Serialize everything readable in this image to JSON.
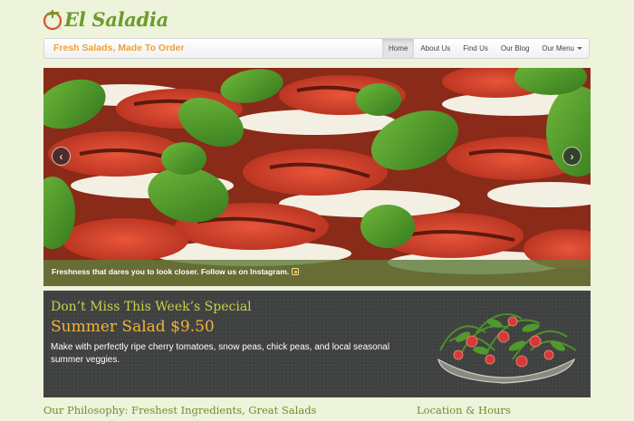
{
  "brand": {
    "name": "El Saladia",
    "accent": "#6d9b2c"
  },
  "navbar": {
    "tagline": "Fresh Salads, Made To Order",
    "items": [
      {
        "label": "Home",
        "active": true
      },
      {
        "label": "About Us"
      },
      {
        "label": "Find Us"
      },
      {
        "label": "Our Blog"
      },
      {
        "label": "Our Menu",
        "dropdown": true
      }
    ]
  },
  "carousel": {
    "caption": "Freshness that dares you to look closer. Follow us on Instagram.",
    "prev_icon": "chevron-left-icon",
    "next_icon": "chevron-right-icon"
  },
  "special": {
    "heading": "Don’t Miss This Week’s Special",
    "title": "Summer Salad $9.50",
    "description": "Make with perfectly ripe cherry tomatoes, snow peas, chick peas, and local seasonal summer veggies."
  },
  "sections": {
    "philosophy": "Our Philosophy: Freshest Ingredients, Great Salads",
    "location": "Location & Hours"
  }
}
